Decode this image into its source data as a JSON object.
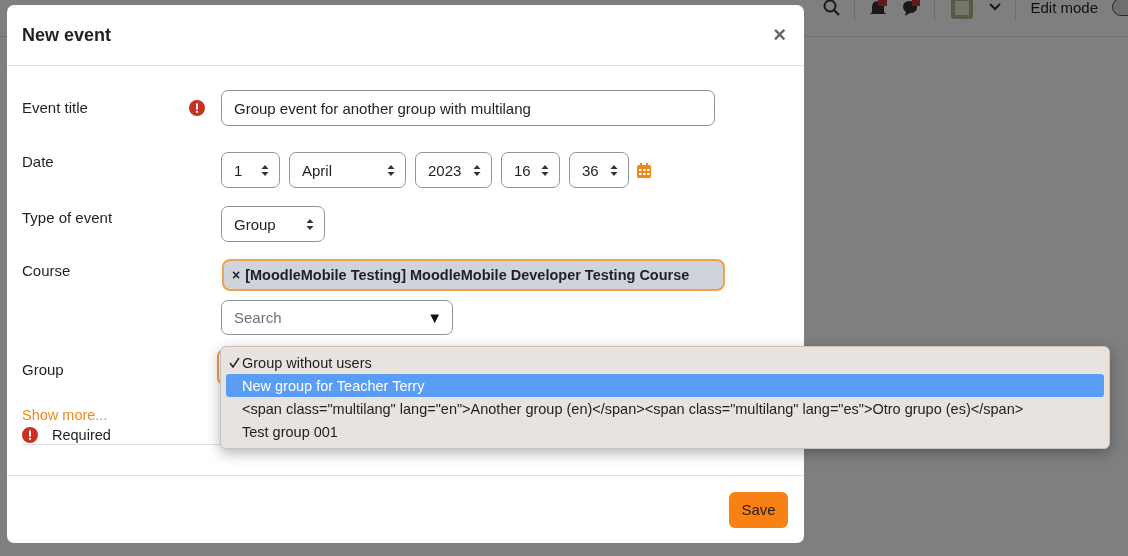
{
  "background_nav": {
    "edit_mode_label": "Edit mode"
  },
  "dialog": {
    "title": "New event",
    "close_symbol": "×",
    "event_title": {
      "label": "Event title",
      "required": true,
      "value": "Group event for another group with multilang"
    },
    "date": {
      "label": "Date",
      "parts": [
        "1",
        "April",
        "2023",
        "16",
        "36"
      ]
    },
    "type_of_event": {
      "label": "Type of event",
      "value": "Group"
    },
    "course": {
      "label": "Course",
      "remove_symbol": "×",
      "selected_item": "[MoodleMobile Testing] MoodleMobile Developer Testing Course",
      "search_placeholder": "Search",
      "dropdown_symbol": "▼"
    },
    "group": {
      "label": "Group",
      "options": [
        {
          "label": "Group without users",
          "checked": true,
          "selected": false
        },
        {
          "label": "New group for Teacher Terry",
          "checked": false,
          "selected": true
        },
        {
          "label": "<span class=\"multilang\" lang=\"en\">Another group (en)</span><span class=\"multilang\" lang=\"es\">Otro grupo (es)</span>",
          "checked": false,
          "selected": false
        },
        {
          "label": "Test group 001",
          "checked": false,
          "selected": false
        }
      ]
    },
    "show_more": "Show more...",
    "required_note": "Required",
    "save_button": "Save"
  }
}
